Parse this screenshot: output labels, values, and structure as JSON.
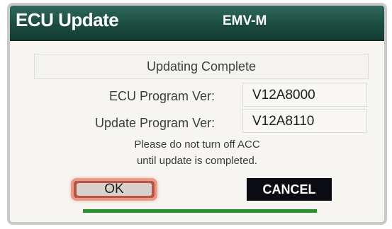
{
  "header": {
    "title": "ECU Update",
    "subtitle": "EMV-M",
    "color": "#1b4c40"
  },
  "status": {
    "text": "Updating Complete"
  },
  "versions": {
    "ecu_label": "ECU Program Ver:",
    "ecu_value": "V12A8000",
    "update_label": "Update Program Ver:",
    "update_value": "V12A8110"
  },
  "notice": {
    "line1": "Please do not turn off ACC",
    "line2": "until update is completed."
  },
  "buttons": {
    "ok_label": "OK",
    "cancel_label": "CANCEL"
  },
  "progress": {
    "fraction": 1.0,
    "color": "#259329"
  }
}
